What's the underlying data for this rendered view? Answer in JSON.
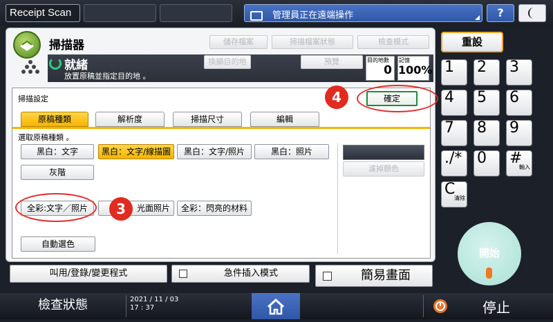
{
  "topbar": {
    "title": "Receipt Scan",
    "remote_status": "管理員正在遠端操作",
    "help_label": "?"
  },
  "scanner": {
    "title": "掃描器",
    "disabled_buttons": [
      "儲存檔案",
      "掃描檔案狀態",
      "檢查模式",
      "預覽"
    ],
    "dest_button": "換顯目的地",
    "status": "就緒",
    "status_sub": "放置原稿並指定目的地 。",
    "dest_count_label": "目的地數",
    "dest_count": "0",
    "memory_label": "記憶",
    "memory": "100%"
  },
  "scan_settings": {
    "title": "掃描設定",
    "ok_label": "確定",
    "tabs": [
      "原稿種類",
      "解析度",
      "掃描尺寸",
      "編輯"
    ],
    "instruction": "選取原稿種類 。",
    "types": {
      "bw_text": "黑白：文字",
      "bw_text_line": "黑白：文字/線描圖",
      "bw_text_photo": "黑白：文字/照片",
      "bw_photo": "黑白：照片",
      "gray": "灰階",
      "fc_text_photo": "全彩:文字／照片",
      "fc_glossy_photo": "全彩：光面照片",
      "fc_glossy_material": "全彩：閃亮的材料",
      "auto_color": "自動選色"
    },
    "drop_color": "濾掉顏色"
  },
  "annotations": {
    "step3": "3",
    "step4": "4"
  },
  "bottom_buttons": {
    "program": "叫用/登錄/變更程式",
    "interrupt": "急件插入模式",
    "simple": "簡易畫面"
  },
  "keypad": {
    "reset": "重設",
    "keys": [
      "1",
      "2",
      "3",
      "4",
      "5",
      "6",
      "7",
      "8",
      "9",
      "./*",
      "0",
      "#"
    ],
    "hash_sub": "輸入",
    "clear": "C",
    "clear_sub": "清除",
    "start": "開始"
  },
  "statusbar": {
    "check_status": "檢查狀態",
    "date": "2021 / 11 / 03",
    "time": "17 : 37",
    "stop": "停止"
  },
  "colors": {
    "accent_yellow": "#f5b400",
    "remote_blue": "#2f58a8",
    "ok_green": "#1f8a3a",
    "annotation_red": "#e02b20",
    "start_teal": "#bfe9e1"
  }
}
